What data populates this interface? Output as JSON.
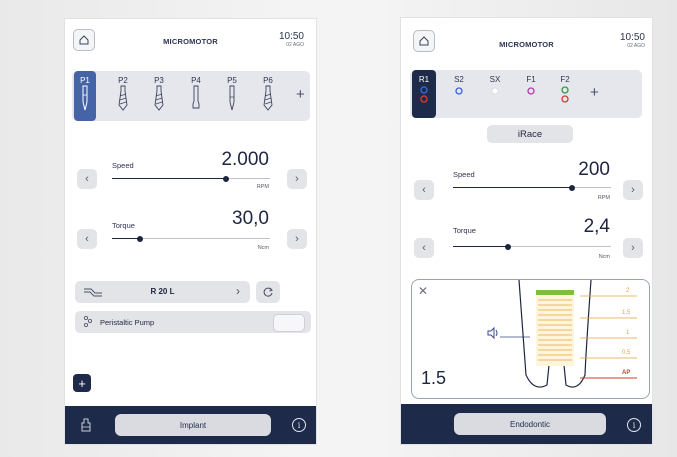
{
  "left": {
    "title": "MICROMOTOR",
    "time": "10:50",
    "date": "02 AGO",
    "programs": [
      "P1",
      "P2",
      "P3",
      "P4",
      "P5",
      "P6"
    ],
    "add_symbol": "+",
    "speed": {
      "label": "Speed",
      "value": "2.000",
      "unit": "RPM",
      "level": 0.72
    },
    "torque": {
      "label": "Torque",
      "value": "30,0",
      "unit": "Ncm",
      "level": 0.18
    },
    "handpiece": "R 20 L",
    "pump_label": "Peristaltic Pump",
    "mode": "Implant"
  },
  "right": {
    "title": "MICROMOTOR",
    "time": "10:50",
    "date": "02 AGO",
    "programs": [
      "R1",
      "S2",
      "SX",
      "F1",
      "F2"
    ],
    "add_symbol": "+",
    "system": "iRace",
    "speed": {
      "label": "Speed",
      "value": "200",
      "unit": "RPM",
      "level": 0.75
    },
    "torque": {
      "label": "Torque",
      "value": "2,4",
      "unit": "Ncm",
      "level": 0.35
    },
    "apex": {
      "reading": "1.5",
      "scale": [
        "2",
        "1.5",
        "1",
        "0.5",
        "AP"
      ]
    },
    "mode": "Endodontic"
  },
  "colors": {
    "navy": "#1d2a4a",
    "selected": "#4564a8",
    "apex_orange": "#e6a23c",
    "apex_red": "#d43a2f",
    "apex_green": "#7dbf3f"
  }
}
